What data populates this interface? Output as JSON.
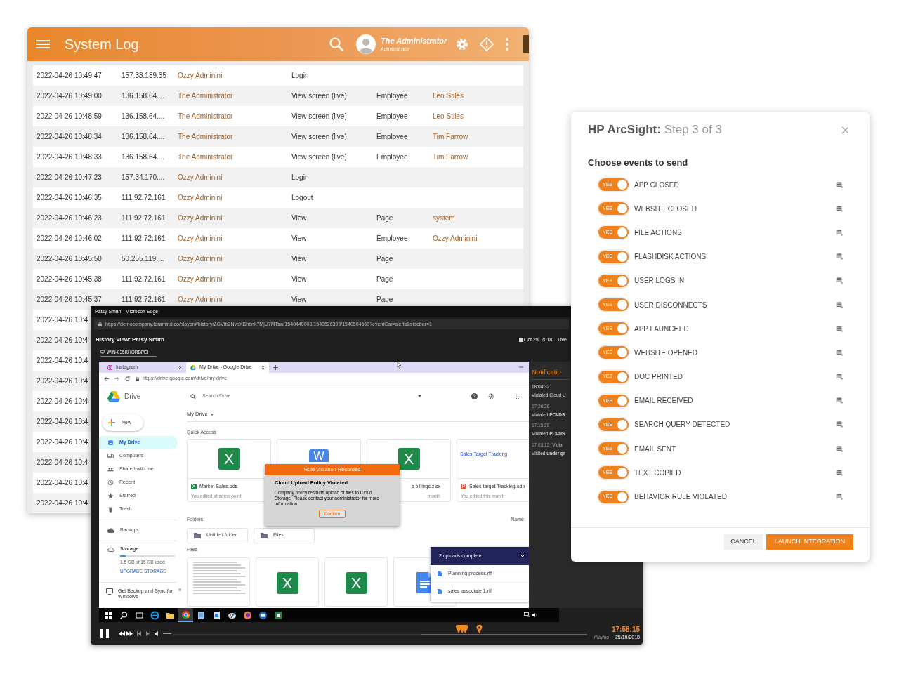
{
  "log_window": {
    "title": "System Log",
    "user_name": "The Administrator",
    "user_role": "Administrator",
    "rows": [
      {
        "time": "2022-04-26 10:49:47",
        "ip": "157.38.139.35",
        "user": "Ozzy Adminini",
        "action": "Login"
      },
      {
        "time": "2022-04-26 10:49:00",
        "ip": "136.158.64....",
        "user": "The Administrator",
        "action": "View screen (live)",
        "object_type": "Employee",
        "target": "Leo Stiles"
      },
      {
        "time": "2022-04-26 10:48:59",
        "ip": "136.158.64....",
        "user": "The Administrator",
        "action": "View screen (live)",
        "object_type": "Employee",
        "target": "Leo Stiles"
      },
      {
        "time": "2022-04-26 10:48:34",
        "ip": "136.158.64....",
        "user": "The Administrator",
        "action": "View screen (live)",
        "object_type": "Employee",
        "target": "Tim Farrow"
      },
      {
        "time": "2022-04-26 10:48:33",
        "ip": "136.158.64....",
        "user": "The Administrator",
        "action": "View screen (live)",
        "object_type": "Employee",
        "target": "Tim Farrow"
      },
      {
        "time": "2022-04-26 10:47:23",
        "ip": "157.34.170....",
        "user": "Ozzy Adminini",
        "action": "Login"
      },
      {
        "time": "2022-04-26 10:46:35",
        "ip": "111.92.72.161",
        "user": "Ozzy Adminini",
        "action": "Logout"
      },
      {
        "time": "2022-04-26 10:46:23",
        "ip": "111.92.72.161",
        "user": "Ozzy Adminini",
        "action": "View",
        "object_type": "Page",
        "target": "system"
      },
      {
        "time": "2022-04-26 10:46:02",
        "ip": "111.92.72.161",
        "user": "Ozzy Adminini",
        "action": "View",
        "object_type": "Employee",
        "target": "Ozzy Adminini"
      },
      {
        "time": "2022-04-26 10:45:50",
        "ip": "50.255.119....",
        "user": "Ozzy Adminini",
        "action": "View",
        "object_type": "Page"
      },
      {
        "time": "2022-04-26 10:45:38",
        "ip": "111.92.72.161",
        "user": "Ozzy Adminini",
        "action": "View",
        "object_type": "Page"
      },
      {
        "time": "2022-04-26 10:45:37",
        "ip": "111.92.72.161",
        "user": "Ozzy Adminini",
        "action": "View",
        "object_type": "Page"
      },
      {
        "time": "2022-04-26 10:4"
      },
      {
        "time": "2022-04-26 10:4"
      },
      {
        "time": "2022-04-26 10:4"
      },
      {
        "time": "2022-04-26 10:4"
      },
      {
        "time": "2022-04-26 10:4"
      },
      {
        "time": "2022-04-26 10:4"
      },
      {
        "time": "2022-04-26 10:4"
      },
      {
        "time": "2022-04-26 10:4"
      },
      {
        "time": "2022-04-26 10:4"
      },
      {
        "time": "2022-04-26 10:4"
      }
    ]
  },
  "player": {
    "browser_title": "Patsy Smith - Microsoft Edge",
    "url": "https://democompany.teramind.co/player#/history/ZGVtb2NvbXBhbnk7MjU7MTsw/1540440000/1540526399/1540504660?eventCat=alerts&sidebar=1",
    "heading": "History view: Patsy Smith",
    "date": "Oct 25, 2018",
    "mode": "Live",
    "computer": "WIN-035KHORBPEI",
    "screen": {
      "tabs": [
        {
          "label": "Instagram",
          "selected": false
        },
        {
          "label": "My Drive - Google Drive",
          "selected": true
        }
      ],
      "url": "https://drive.google.com/drive/my-drive",
      "app_name": "Drive",
      "search_placeholder": "Search Drive",
      "new_button": "New",
      "nav": [
        {
          "kind": "drive",
          "label": "My Drive",
          "selected": true
        },
        {
          "kind": "computer",
          "label": "Computers",
          "selected": false
        },
        {
          "kind": "people",
          "label": "Shared with me",
          "selected": false
        },
        {
          "kind": "clock",
          "label": "Recent",
          "selected": false
        },
        {
          "kind": "star",
          "label": "Starred",
          "selected": false
        },
        {
          "kind": "trash",
          "label": "Trash",
          "selected": false
        }
      ],
      "backups": "Backups",
      "storage": {
        "label": "Storage",
        "level": 0.1,
        "usage": "1.5 GB of 15 GB used",
        "upgrade": "UPGRADE STORAGE"
      },
      "backup_promo": "Get Backup and Sync for Windows",
      "location": "My Drive",
      "quick_access_label": "Quick Access",
      "quick_access": [
        {
          "kind": "sheet",
          "letter": "X",
          "type_letter": "X",
          "name": "Market Sales.ods",
          "meta": "You edited at some point"
        },
        {
          "kind": "doc",
          "letter": "W"
        },
        {
          "kind": "sheet",
          "letter": "X",
          "name": "e billings.xlsx",
          "meta": "month"
        },
        {
          "kind": "slides",
          "preview": "Sales Target Tracking",
          "type_letter": "P",
          "name": "Sales target Tracking.odp",
          "meta": "You edited this month"
        }
      ],
      "folders_label": "Folders",
      "sort_label": "Name",
      "folders": [
        "Untitled folder",
        "Files"
      ],
      "files_label": "Files",
      "files": [
        {
          "kind": "text"
        },
        {
          "kind": "sheet",
          "letter": "X"
        },
        {
          "kind": "sheet",
          "letter": "X"
        },
        {
          "kind": "doc"
        }
      ],
      "alert": {
        "title": "Rule Violation Recorded",
        "heading": "Cloud Upload Policy Violated",
        "message": "Company policy restricts upload of files to Cloud Storage. Please contact your administrator for more information.",
        "button": "Confirm"
      },
      "uploads": {
        "title": "2 uploads complete",
        "files": [
          "Planning process.rtf",
          "sales associate 1.rtf"
        ]
      }
    },
    "notifications": {
      "title": "Notificatio",
      "items": [
        {
          "time": "18:04:32",
          "text": "Violated Cloud U"
        },
        {
          "time": "17:26:26",
          "text": "Violated **PCI-DS**"
        },
        {
          "time": "17:15:28",
          "text": "Violated **PCI-DS**"
        },
        {
          "time": "17:03:15",
          "tag": "Viola",
          "text": "Visited **under gr**"
        }
      ]
    },
    "taskbar": [
      {
        "kind": "start",
        "selected": false
      },
      {
        "kind": "search",
        "selected": false
      },
      {
        "kind": "taskview",
        "selected": false
      },
      {
        "kind": "ie",
        "selected": false
      },
      {
        "kind": "folder",
        "selected": false
      },
      {
        "kind": "chrome",
        "selected": true
      },
      {
        "kind": "notepad",
        "selected": false
      },
      {
        "kind": "doc",
        "selected": false
      },
      {
        "kind": "paint",
        "selected": false
      },
      {
        "kind": "firefox",
        "selected": false
      },
      {
        "kind": "mail",
        "selected": false
      },
      {
        "kind": "sheet",
        "selected": false
      }
    ],
    "playback": {
      "level": 0.6,
      "time": "17:58:15",
      "date": "25/10/2018",
      "state": "Playing"
    }
  },
  "integration_dialog": {
    "title": "**HP ArcSight:** Step 3 of 3",
    "section": "Choose events to send",
    "events": [
      {
        "label": "APP CLOSED",
        "toggle": "YES",
        "on": true
      },
      {
        "label": "WEBSITE CLOSED",
        "toggle": "YES",
        "on": true
      },
      {
        "label": "FILE ACTIONS",
        "toggle": "YES",
        "on": true
      },
      {
        "label": "FLASHDISK ACTIONS",
        "toggle": "YES",
        "on": true
      },
      {
        "label": "USER LOGS IN",
        "toggle": "YES",
        "on": true
      },
      {
        "label": "USER DISCONNECTS",
        "toggle": "YES",
        "on": true
      },
      {
        "label": "APP LAUNCHED",
        "toggle": "YES",
        "on": true
      },
      {
        "label": "WEBSITE OPENED",
        "toggle": "YES",
        "on": true
      },
      {
        "label": "DOC PRINTED",
        "toggle": "YES",
        "on": true
      },
      {
        "label": "EMAIL RECEIVED",
        "toggle": "YES",
        "on": true
      },
      {
        "label": "SEARCH QUERY DETECTED",
        "toggle": "YES",
        "on": true
      },
      {
        "label": "EMAIL SENT",
        "toggle": "YES",
        "on": true
      },
      {
        "label": "TEXT COPIED",
        "toggle": "YES",
        "on": true
      },
      {
        "label": "BEHAVIOR RULE VIOLATED",
        "toggle": "YES",
        "on": true
      }
    ],
    "buttons": [
      {
        "label": "CANCEL",
        "kind": "secondary"
      },
      {
        "label": "LAUNCH INTEGRATION",
        "kind": "primary"
      }
    ]
  }
}
